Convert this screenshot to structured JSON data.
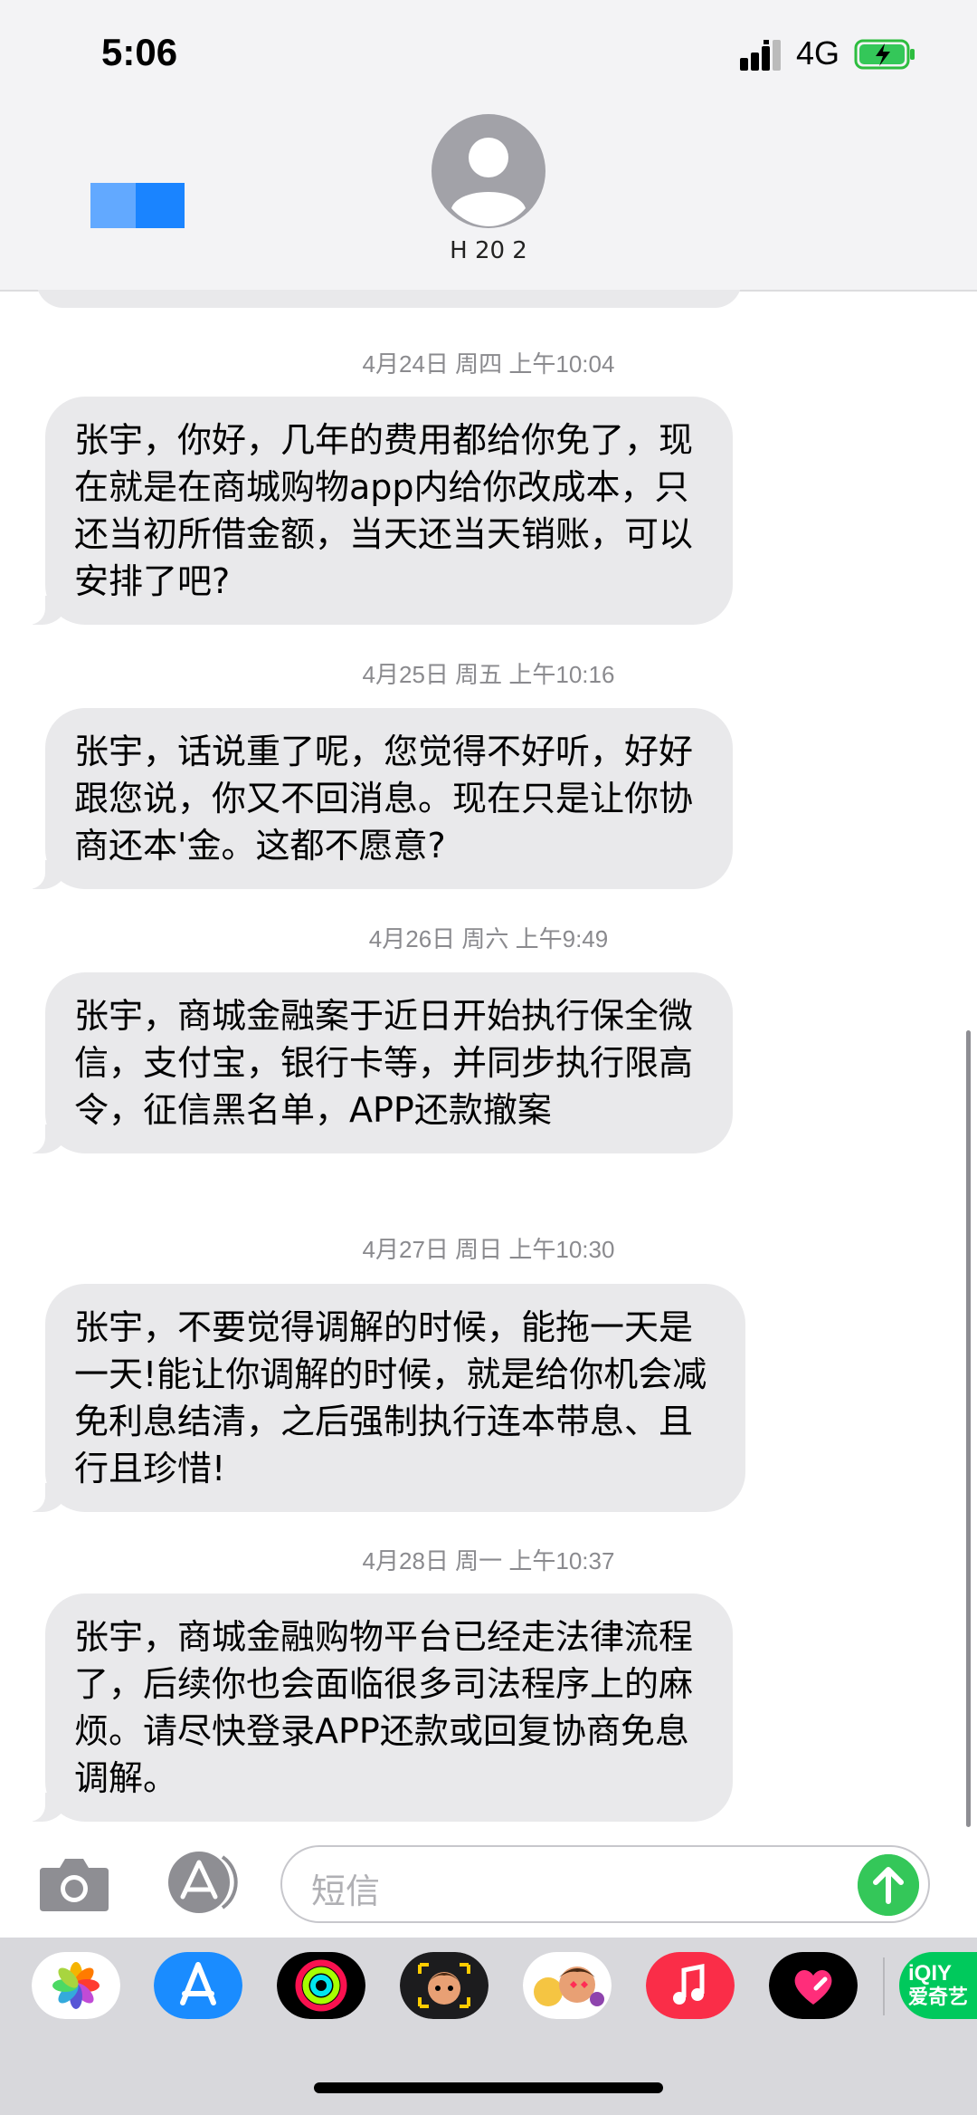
{
  "status_bar": {
    "time": "5:06",
    "network": "4G"
  },
  "header": {
    "contact_name": "H              20 2"
  },
  "messages": [
    {
      "timestamp": "4月24日 周四 上午10:04",
      "text": "张宇，你好，几年的费用都给你免了，现在就是在商城购物app内给你改成本，只还当初所借金额，当天还当天销账，可以安排了吧?"
    },
    {
      "timestamp": "4月25日 周五 上午10:16",
      "text": "张宇，话说重了呢，您觉得不好听，好好跟您说，你又不回消息。现在只是让你协商还本'金。这都不愿意?"
    },
    {
      "timestamp": "4月26日 周六 上午9:49",
      "text": "张宇，商城金融案于近日开始执行保全微信，支付宝，银行卡等，并同步执行限高令，征信黑名单，APP还款撤案"
    },
    {
      "timestamp": "4月27日 周日 上午10:30",
      "text": "张宇，不要觉得调解的时候，能拖一天是一天!能让你调解的时候，就是给你机会减免利息结清，之后强制执行连本带息、且行且珍惜!"
    },
    {
      "timestamp": "4月28日 周一 上午10:37",
      "text": "张宇，商城金融购物平台已经走法律流程了，后续你也会面临很多司法程序上的麻烦。请尽快登录APP还款或回复协商免息调解。"
    }
  ],
  "input": {
    "placeholder": "短信"
  },
  "apps": [
    {
      "name": "photos-app-icon"
    },
    {
      "name": "app-store-app-icon"
    },
    {
      "name": "fitness-app-icon"
    },
    {
      "name": "memoji-app-icon"
    },
    {
      "name": "animoji-app-icon"
    },
    {
      "name": "music-app-icon"
    },
    {
      "name": "digital-touch-app-icon"
    },
    {
      "name": "iqiyi-app-icon",
      "label_line1": "iQIY",
      "label_line2": "爱奇艺"
    }
  ],
  "colors": {
    "bubble": "#e9e9eb",
    "send": "#34c759",
    "accent": "#1a84ff"
  }
}
